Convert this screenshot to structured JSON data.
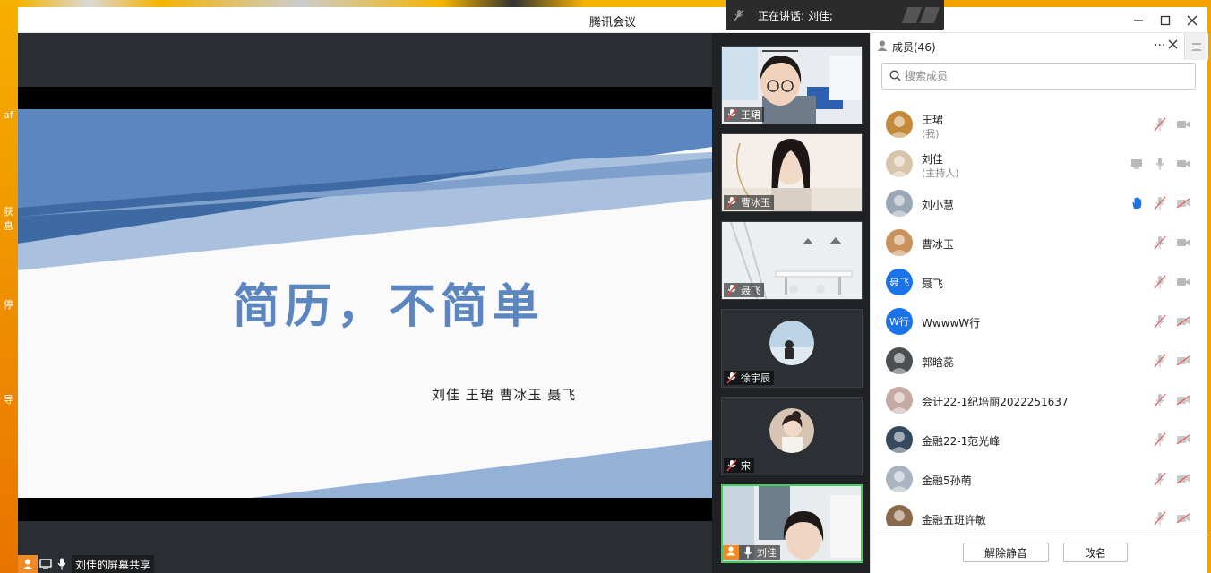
{
  "window": {
    "title": "腾讯会议"
  },
  "speaking": {
    "label": "正在讲话: 刘佳;"
  },
  "desktop": {
    "fragments": [
      "af",
      "获",
      "息",
      "停",
      "导"
    ]
  },
  "slide": {
    "title": "简历，不简单",
    "subtitle": "刘佳   王珺  曹冰玉  聂飞"
  },
  "share": {
    "label": "刘佳的屏幕共享"
  },
  "colors": {
    "accent": "#1a73e8",
    "active_border": "#3fcf5e",
    "slide_blue": "#5b86bf",
    "share_orange": "#f08a24"
  },
  "thumbnails": [
    {
      "name": "王珺",
      "type": "photo",
      "muted": true
    },
    {
      "name": "曹冰玉",
      "type": "photo",
      "muted": true
    },
    {
      "name": "聂飞",
      "type": "photo",
      "muted": true
    },
    {
      "name": "徐宇辰",
      "type": "avatar",
      "muted": true
    },
    {
      "name": "宋",
      "type": "avatar",
      "muted": true
    },
    {
      "name": "刘佳",
      "type": "photo",
      "muted": false,
      "active": true
    }
  ],
  "panel": {
    "title": "成员(46)",
    "search_placeholder": "搜索成员",
    "unmute_button": "解除静音",
    "rename_button": "改名",
    "members": [
      {
        "name": "王珺",
        "role": "(我)",
        "avatar_color": "#c48a3a",
        "mic": "muted",
        "cam": "on",
        "screen": false,
        "hand": false
      },
      {
        "name": "刘佳",
        "role": "(主持人)",
        "avatar_color": "#d8c4a8",
        "mic": "on",
        "cam": "on",
        "screen": true,
        "hand": false
      },
      {
        "name": "刘小慧",
        "role": "",
        "avatar_color": "#9aa7b4",
        "mic": "muted",
        "cam": "off",
        "screen": false,
        "hand": true
      },
      {
        "name": "曹冰玉",
        "role": "",
        "avatar_color": "#c9925a",
        "mic": "muted",
        "cam": "on",
        "screen": false,
        "hand": false
      },
      {
        "name": "聂飞",
        "role": "",
        "avatar_color": "#1a73e8",
        "avatar_text": "聂飞",
        "mic": "muted",
        "cam": "on",
        "screen": false,
        "hand": false
      },
      {
        "name": "WwwwW行",
        "role": "",
        "avatar_color": "#1a73e8",
        "avatar_text": "W行",
        "mic": "muted",
        "cam": "off",
        "screen": false,
        "hand": false
      },
      {
        "name": "郭晗蕊",
        "role": "",
        "avatar_color": "#4b4f52",
        "mic": "muted",
        "cam": "off",
        "screen": false,
        "hand": false
      },
      {
        "name": "会计22-1纪培丽2022251637",
        "role": "",
        "avatar_color": "#c7a9a4",
        "mic": "muted",
        "cam": "off",
        "screen": false,
        "hand": false
      },
      {
        "name": "金融22-1范光峰",
        "role": "",
        "avatar_color": "#34495e",
        "mic": "muted",
        "cam": "off",
        "screen": false,
        "hand": false
      },
      {
        "name": "金融5孙萌",
        "role": "",
        "avatar_color": "#a8b5c0",
        "mic": "muted",
        "cam": "off",
        "screen": false,
        "hand": false
      },
      {
        "name": "金融五班许敏",
        "role": "",
        "avatar_color": "#8a6a4a",
        "mic": "muted",
        "cam": "off",
        "screen": false,
        "hand": false
      }
    ]
  }
}
